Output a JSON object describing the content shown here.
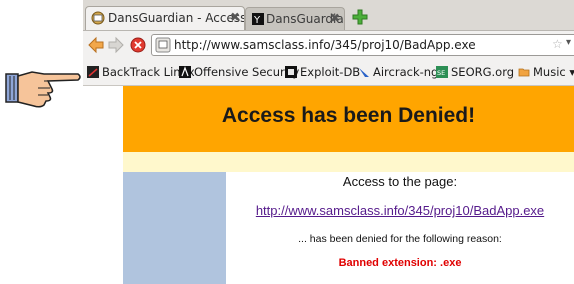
{
  "tabs": [
    {
      "label": "DansGuardian - Access Denied",
      "close": "✖",
      "active": true
    },
    {
      "label": "DansGuardian - Access Denied",
      "close": "✖",
      "active": false
    }
  ],
  "newtab_icon": "plus-icon",
  "toolbar": {
    "back_icon": "back-arrow-icon",
    "forward_icon": "forward-arrow-icon",
    "stop_icon": "stop-icon",
    "url": "http://www.samsclass.info/345/proj10/BadApp.exe",
    "star": "☆",
    "dropdown": "▾",
    "reload": "C"
  },
  "bookmarks": [
    {
      "label": "BackTrack Linux",
      "icon": "backtrack-icon"
    },
    {
      "label": "Offensive Security",
      "icon": "offensive-security-icon"
    },
    {
      "label": "Exploit-DB",
      "icon": "exploit-db-icon"
    },
    {
      "label": "Aircrack-ng",
      "icon": "aircrack-icon"
    },
    {
      "label": "SEORG.org",
      "icon": "seorg-icon"
    },
    {
      "label": "Music ▾",
      "icon": "folder-icon"
    }
  ],
  "page": {
    "heading": "Access has been Denied!",
    "intro": "Access to the page:",
    "link": "http://www.samsclass.info/345/proj10/BadApp.exe",
    "reason_text": "... has been denied for the following reason:",
    "reason": "Banned extension: .exe"
  },
  "colors": {
    "banner": "#ffa500",
    "cream": "#fff8cc",
    "sidebar": "#b0c4de",
    "reason": "#e00000",
    "link": "#551a8b"
  }
}
